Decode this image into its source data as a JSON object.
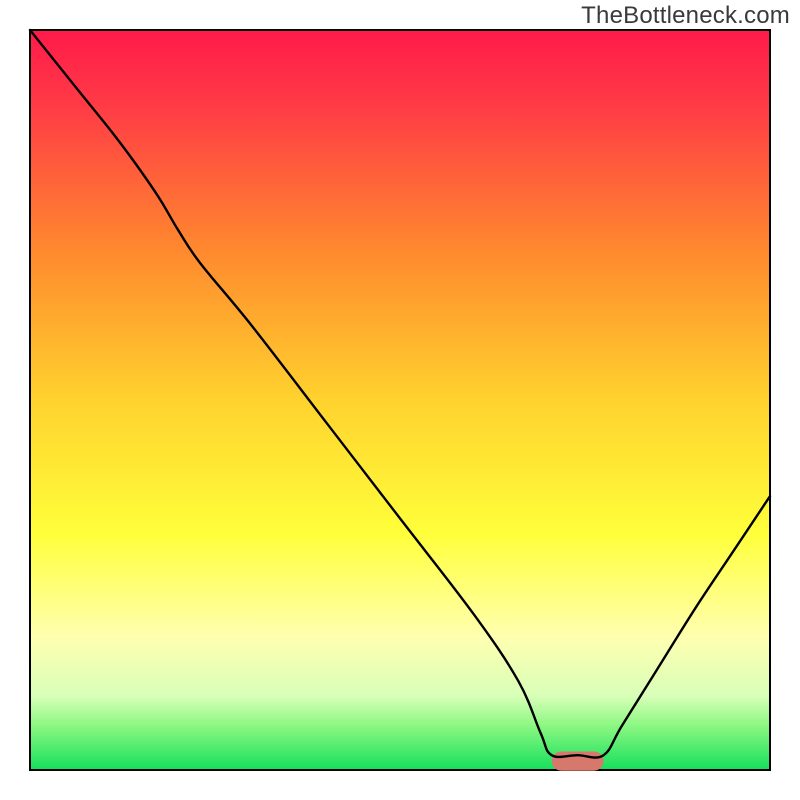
{
  "watermark": "TheBottleneck.com",
  "chart_data": {
    "type": "line",
    "xlim": [
      0,
      100
    ],
    "ylim": [
      0,
      100
    ],
    "title": "",
    "xlabel": "",
    "ylabel": "",
    "background_gradient": {
      "stops": [
        {
          "offset": 0.0,
          "color": "#ff1a4a"
        },
        {
          "offset": 0.1,
          "color": "#ff3a46"
        },
        {
          "offset": 0.3,
          "color": "#ff8a2e"
        },
        {
          "offset": 0.5,
          "color": "#ffd22e"
        },
        {
          "offset": 0.68,
          "color": "#ffff3a"
        },
        {
          "offset": 0.82,
          "color": "#ffffb0"
        },
        {
          "offset": 0.9,
          "color": "#d8ffb8"
        },
        {
          "offset": 0.94,
          "color": "#8cf782"
        },
        {
          "offset": 1.0,
          "color": "#14e05c"
        }
      ]
    },
    "marker": {
      "x_start": 70.5,
      "x_end": 77.5,
      "y": 1.2,
      "height": 2.6,
      "color": "#d6786b",
      "corner_radius": 1.3
    },
    "series": [
      {
        "name": "bottleneck-curve",
        "color": "#000000",
        "width": 2.4,
        "points": [
          {
            "x": 0.0,
            "y": 100.0
          },
          {
            "x": 6.0,
            "y": 92.5
          },
          {
            "x": 12.0,
            "y": 85.0
          },
          {
            "x": 17.0,
            "y": 78.0
          },
          {
            "x": 20.0,
            "y": 73.0
          },
          {
            "x": 23.0,
            "y": 68.5
          },
          {
            "x": 30.0,
            "y": 60.0
          },
          {
            "x": 40.0,
            "y": 47.0
          },
          {
            "x": 50.0,
            "y": 34.0
          },
          {
            "x": 60.0,
            "y": 21.0
          },
          {
            "x": 66.0,
            "y": 12.0
          },
          {
            "x": 69.0,
            "y": 5.0
          },
          {
            "x": 70.5,
            "y": 2.0
          },
          {
            "x": 74.0,
            "y": 2.0
          },
          {
            "x": 77.5,
            "y": 2.0
          },
          {
            "x": 80.0,
            "y": 6.0
          },
          {
            "x": 85.0,
            "y": 14.0
          },
          {
            "x": 90.0,
            "y": 22.0
          },
          {
            "x": 95.0,
            "y": 29.5
          },
          {
            "x": 100.0,
            "y": 37.0
          }
        ]
      }
    ]
  }
}
